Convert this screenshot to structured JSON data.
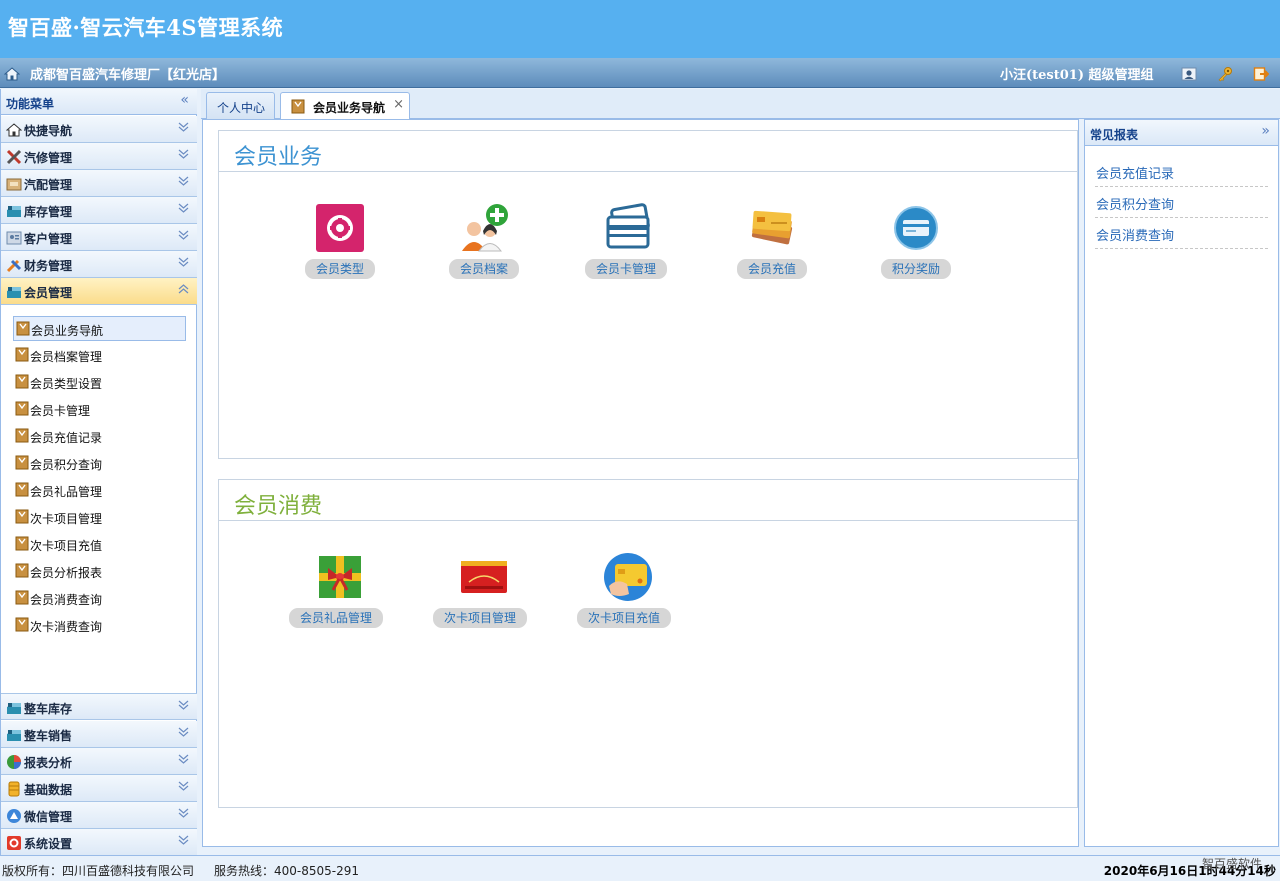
{
  "header": {
    "app_title": "智百盛·智云汽车4S管理系统",
    "shop_name": "成都智百盛汽车修理厂【红光店】",
    "user_info": "小汪(test01) 超级管理组"
  },
  "sidebar": {
    "title": "功能菜单",
    "collapse_icon": "«",
    "top_items": [
      {
        "label": "快捷导航",
        "icon": "home-icon"
      },
      {
        "label": "汽修管理",
        "icon": "tools-icon"
      },
      {
        "label": "汽配管理",
        "icon": "parts-icon"
      },
      {
        "label": "库存管理",
        "icon": "warehouse-icon"
      },
      {
        "label": "客户管理",
        "icon": "contact-icon"
      },
      {
        "label": "财务管理",
        "icon": "finance-icon"
      },
      {
        "label": "会员管理",
        "icon": "member-icon"
      }
    ],
    "sub_items": [
      "会员业务导航",
      "会员档案管理",
      "会员类型设置",
      "会员卡管理",
      "会员充值记录",
      "会员积分查询",
      "会员礼品管理",
      "次卡项目管理",
      "次卡项目充值",
      "会员分析报表",
      "会员消费查询",
      "次卡消费查询"
    ],
    "bottom_items": [
      {
        "label": "整车库存",
        "icon": "vehicle-stock-icon"
      },
      {
        "label": "整车销售",
        "icon": "vehicle-sales-icon"
      },
      {
        "label": "报表分析",
        "icon": "pie-chart-icon"
      },
      {
        "label": "基础数据",
        "icon": "database-icon"
      },
      {
        "label": "微信管理",
        "icon": "wechat-icon"
      },
      {
        "label": "系统设置",
        "icon": "settings-icon"
      }
    ]
  },
  "tabs": [
    {
      "label": "个人中心"
    },
    {
      "label": "会员业务导航",
      "close": "×"
    }
  ],
  "main": {
    "business": {
      "title": "会员业务",
      "color": "#3d93d2",
      "tiles": [
        "会员类型",
        "会员档案",
        "会员卡管理",
        "会员充值",
        "积分奖励"
      ]
    },
    "consumption": {
      "title": "会员消费",
      "color": "#7fb03c",
      "tiles": [
        "会员礼品管理",
        "次卡项目管理",
        "次卡项目充值"
      ]
    }
  },
  "right_panel": {
    "title": "常见报表",
    "expand_icon": "»",
    "links": [
      "会员充值记录",
      "会员积分查询",
      "会员消费查询"
    ]
  },
  "footer": {
    "copyright": "版权所有：四川百盛德科技有限公司",
    "hotline": "服务热线：400-8505-291",
    "clock": "2020年6月16日1时44分14秒",
    "watermark": "智百盛软件"
  },
  "colors": {
    "topbar": "#56b0f0",
    "accent_blue": "#3d93d2",
    "accent_green": "#7fb03c",
    "active_menu": "#fbdc8b"
  }
}
